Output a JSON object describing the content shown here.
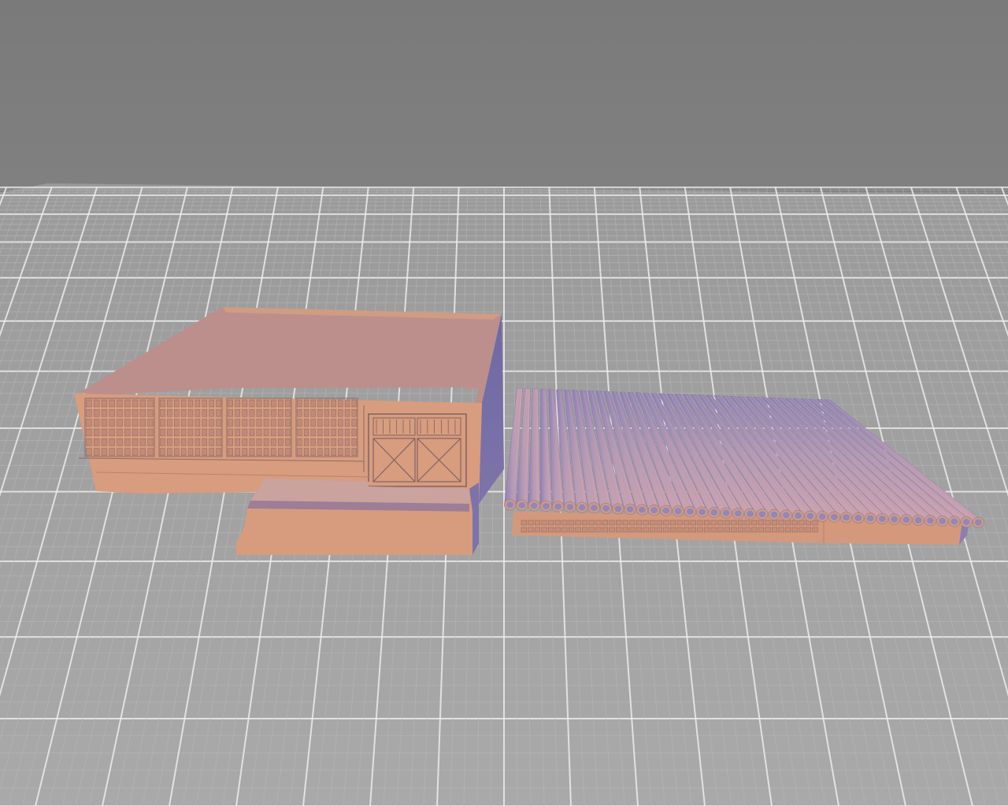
{
  "viewport": {
    "type": "3d-model-preview",
    "background_color": "#7c7c7c",
    "floor_color": "#a6a6a6",
    "grid_minor_color": "#b9b9b9",
    "grid_major_color": "#ececec",
    "show_grid": true
  },
  "scene": {
    "objects": [
      {
        "name": "building-walls",
        "description_color_light": "#d89c7e",
        "description_color_shade": "#7f78ab"
      },
      {
        "name": "roof-tubes",
        "tube_count": 40,
        "description_color_light": "#c7a1ac",
        "description_color_shade": "#8e83b7"
      }
    ],
    "colors": {
      "wall_light": "#d89c7e",
      "wall_mid": "#c88f78",
      "wall_shade": "#7f77ab",
      "wall_dark": "#6f6a9e",
      "wall_line": "#8a6c6a",
      "tube_top": "#b79ab6",
      "tube_light": "#caa3ae",
      "tube_dark": "#8b7fb4",
      "tube_end": "#cf9c88"
    }
  }
}
